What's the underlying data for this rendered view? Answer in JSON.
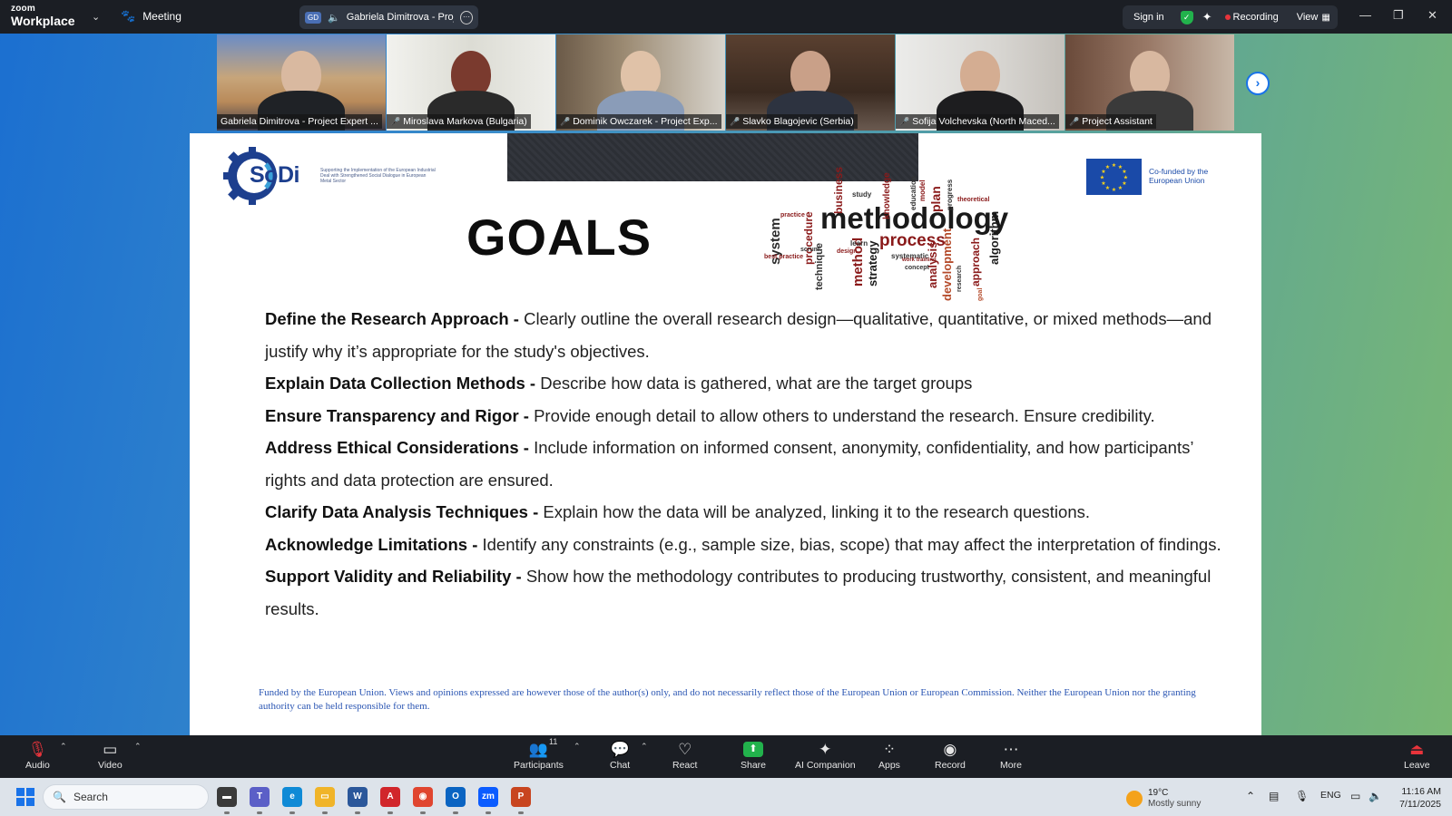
{
  "titlebar": {
    "logo_top": "zoom",
    "logo_bottom": "Workplace",
    "meeting_label": "Meeting",
    "speaker_badge": "GD",
    "active_speaker": "Gabriela Dimitrova - Project E",
    "sign_in": "Sign in",
    "recording_label": "Recording",
    "view_label": "View"
  },
  "gallery": [
    {
      "name": "Gabriela Dimitrova - Project Expert ...",
      "muted": false,
      "active": true
    },
    {
      "name": "Miroslava Markova (Bulgaria)",
      "muted": true,
      "active": false
    },
    {
      "name": "Dominik Owczarek - Project Exp...",
      "muted": true,
      "active": false
    },
    {
      "name": "Slavko Blagojevic (Serbia)",
      "muted": true,
      "active": false
    },
    {
      "name": "Sofija Volchevska (North Maced...",
      "muted": true,
      "active": false
    },
    {
      "name": "Project Assistant",
      "muted": true,
      "active": false
    }
  ],
  "slide": {
    "sodi_logo": "SoDi",
    "sodi_tagline": "Supporting the Implementation of the European Industrial Deal with Strengthened Social Dialogue in European Metal Sector",
    "eu_text_line1": "Co-funded by the",
    "eu_text_line2": "European Union",
    "heading": "GOALS",
    "wordcloud": [
      "methodology",
      "process",
      "system",
      "procedure",
      "technique",
      "method",
      "strategy",
      "analysis",
      "development",
      "approach",
      "algorithm",
      "business",
      "study",
      "knowledge",
      "plan",
      "progress",
      "theoretical",
      "practice",
      "best practice",
      "learn",
      "design",
      "systematic",
      "concept",
      "work training",
      "scrum",
      "education",
      "model",
      "goal",
      "research"
    ],
    "goals": [
      {
        "title": "Define the Research Approach - ",
        "text": "Clearly outline the overall research design—qualitative, quantitative, or mixed methods—and justify why it’s appropriate for the study's objectives."
      },
      {
        "title": "Explain Data Collection Methods - ",
        "text": "Describe how data is gathered, what are the target groups"
      },
      {
        "title": "Ensure Transparency and Rigor - ",
        "text": "Provide enough detail to allow others to understand the research. Ensure credibility."
      },
      {
        "title": "Address Ethical Considerations - ",
        "text": "Include information on informed consent, anonymity, confidentiality, and how participants’ rights and data protection are ensured."
      },
      {
        "title": "Clarify Data Analysis Techniques - ",
        "text": "Explain how the data will be analyzed, linking it to the research questions."
      },
      {
        "title": "Acknowledge Limitations - ",
        "text": "Identify any constraints (e.g., sample size, bias, scope) that may affect the interpretation of findings."
      },
      {
        "title": "Support Validity and Reliability - ",
        "text": "Show how the methodology contributes to producing trustworthy, consistent, and meaningful results."
      }
    ],
    "disclaimer": "Funded by the European Union. Views and opinions expressed are however those of the author(s) only, and do not necessarily reflect those of the European Union or European Commission. Neither the European Union nor the granting authority can be held responsible for them."
  },
  "toolbar": {
    "audio": "Audio",
    "video": "Video",
    "participants": "Participants",
    "participant_count": "11",
    "chat": "Chat",
    "react": "React",
    "share": "Share",
    "ai_companion": "AI Companion",
    "apps": "Apps",
    "record": "Record",
    "more": "More",
    "leave": "Leave"
  },
  "taskbar": {
    "search_placeholder": "Search",
    "weather_temp": "19°C",
    "weather_cond": "Mostly sunny",
    "lang": "ENG",
    "time": "11:16 AM",
    "date": "7/11/2025",
    "apps": [
      {
        "icon": "file-explorer-dark-icon",
        "color": "#3a3a3a",
        "glyph": "▬"
      },
      {
        "icon": "teams-icon",
        "color": "#5b5fc7",
        "glyph": "T"
      },
      {
        "icon": "edge-icon",
        "color": "#0f8ad6",
        "glyph": "e"
      },
      {
        "icon": "folder-icon",
        "color": "#f0b429",
        "glyph": "▭"
      },
      {
        "icon": "word-icon",
        "color": "#2b579a",
        "glyph": "W"
      },
      {
        "icon": "acrobat-icon",
        "color": "#d1262b",
        "glyph": "A"
      },
      {
        "icon": "chrome-icon",
        "color": "#e0452f",
        "glyph": "◉"
      },
      {
        "icon": "outlook-icon",
        "color": "#0a64c2",
        "glyph": "O"
      },
      {
        "icon": "zoom-icon",
        "color": "#0b5cff",
        "glyph": "zm"
      },
      {
        "icon": "powerpoint-icon",
        "color": "#c8451f",
        "glyph": "P"
      }
    ]
  },
  "colors": {
    "zoom_dark": "#1b1e24",
    "active_tile": "#2bd46a",
    "recording_red": "#e8343b",
    "share_green": "#22b24c",
    "eu_blue": "#1a4aa8",
    "sodi_blue": "#1d3f8e",
    "disclaimer_blue": "#2b56b3"
  }
}
